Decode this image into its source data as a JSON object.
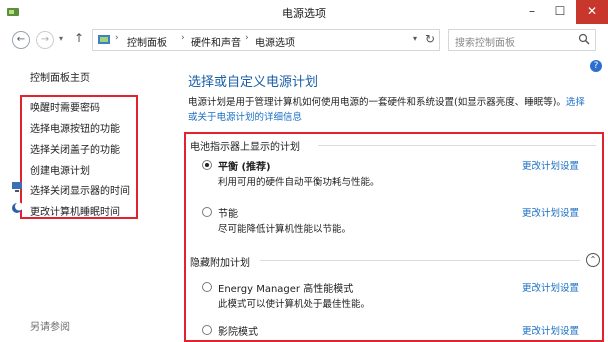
{
  "window": {
    "title": "电源选项"
  },
  "address": {
    "crumbs": [
      "控制面板",
      "硬件和声音",
      "电源选项"
    ]
  },
  "search": {
    "placeholder": "搜索控制面板"
  },
  "sidebar": {
    "home": "控制面板主页",
    "items": [
      {
        "label": "唤醒时需要密码"
      },
      {
        "label": "选择电源按钮的功能"
      },
      {
        "label": "选择关闭盖子的功能"
      },
      {
        "label": "创建电源计划"
      },
      {
        "label": "选择关闭显示器的时间"
      },
      {
        "label": "更改计算机睡眠时间"
      }
    ],
    "see_also": "另请参阅"
  },
  "main": {
    "title": "选择或自定义电源计划",
    "desc_line1": "电源计划是用于管理计算机如何使用电源的一套硬件和系统设置(如显示器亮度、睡眠等)。",
    "desc_link_a": "选择",
    "desc_link_b": "或关于电源计划的详细信息"
  },
  "plans": {
    "battery_header": "电池指示器上显示的计划",
    "hidden_header": "隐藏附加计划",
    "change_label": "更改计划设置",
    "items": [
      {
        "name": "平衡 (推荐)",
        "desc": "利用可用的硬件自动平衡功耗与性能。",
        "selected": true
      },
      {
        "name": "节能",
        "desc": "尽可能降低计算机性能以节能。",
        "selected": false
      },
      {
        "name": "Energy Manager 高性能模式",
        "desc": "此模式可以使计算机处于最佳性能。",
        "selected": false
      },
      {
        "name": "影院模式",
        "desc": "",
        "selected": false
      }
    ]
  },
  "colors": {
    "accent": "#1a5ea8",
    "link": "#1a6fc4",
    "highlight": "#e0232f"
  }
}
